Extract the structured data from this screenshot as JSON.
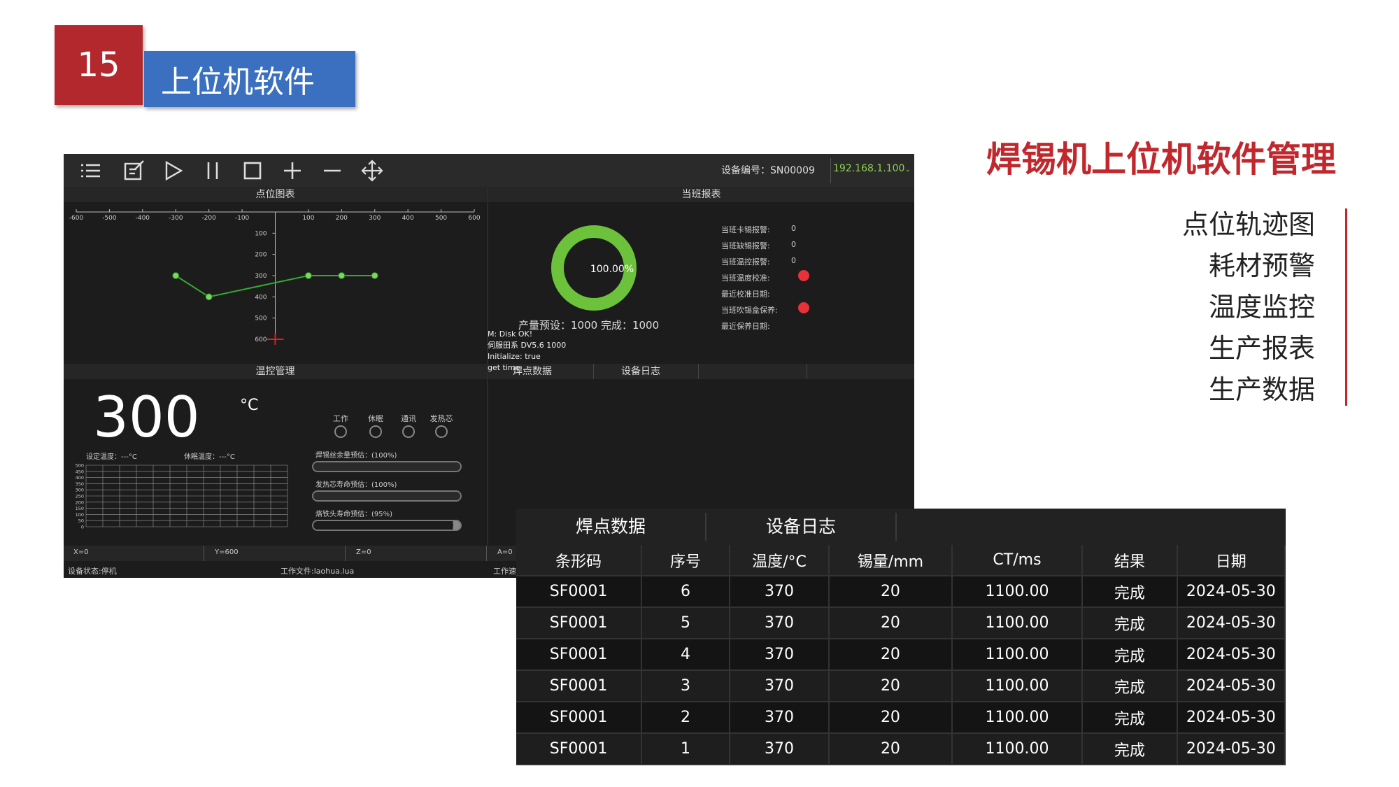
{
  "slide": {
    "number": "15",
    "title": "上位机软件",
    "heading": "焊锡机上位机软件管理",
    "features": [
      "点位轨迹图",
      "耗材预警",
      "温度监控",
      "生产报表",
      "生产数据"
    ]
  },
  "toolbar": {
    "icons": [
      "menu-icon",
      "edit-icon",
      "play-icon",
      "pause-icon",
      "stop-icon",
      "plus-icon",
      "minus-icon",
      "move-icon"
    ],
    "device_id": "设备编号：SN00009",
    "ip": "192.168.1.100"
  },
  "panels": {
    "point_chart": "点位图表",
    "shift_report": "当班报表",
    "temp_management": "温控管理",
    "solder_data_tab": "焊点数据",
    "device_log_tab": "设备日志"
  },
  "chart_data": {
    "type": "line",
    "x_ticks": [
      "-600",
      "-500",
      "-400",
      "-300",
      "-200",
      "-100",
      "100",
      "200",
      "300",
      "400",
      "500",
      "600"
    ],
    "y_ticks": [
      "100",
      "200",
      "300",
      "400",
      "500",
      "600"
    ],
    "x": [
      -300,
      -200,
      100,
      200,
      300
    ],
    "y": [
      300,
      400,
      300,
      300,
      300
    ],
    "xlim": [
      -600,
      600
    ],
    "ylim": [
      0,
      600
    ],
    "line_color": "#33aa33",
    "point_color": "#7ad85a"
  },
  "shift": {
    "donut_percent": 100,
    "donut_label": "100.00%",
    "production": "产量预设：1000  完成：1000",
    "rows": [
      {
        "label": "当班卡锡报警:",
        "value": "0"
      },
      {
        "label": "当班缺锡报警:",
        "value": "0"
      },
      {
        "label": "当班温控报警:",
        "value": "0"
      },
      {
        "label": "当班温度校准:",
        "value": ""
      },
      {
        "label": "最近校准日期:",
        "value": ""
      },
      {
        "label": "当班吹锡盒保养:",
        "value": ""
      },
      {
        "label": "最近保养日期:",
        "value": ""
      }
    ]
  },
  "temperature": {
    "value": "300",
    "unit": "°C",
    "status_labels": [
      "工作",
      "休眠",
      "通讯",
      "发热芯"
    ],
    "set_temp": "设定温度：---°C",
    "sleep_temp": "休眠温度：---°C",
    "grid_ticks": [
      "500",
      "450",
      "400",
      "350",
      "300",
      "250",
      "200",
      "150",
      "100",
      "50",
      "0"
    ],
    "bars": [
      {
        "label": "焊锡丝余量预估：(100%)",
        "percent": 100
      },
      {
        "label": "发热芯寿命预估：(100%)",
        "percent": 100
      },
      {
        "label": "烙铁头寿命预估：(95%)",
        "percent": 95
      }
    ]
  },
  "log": [
    "M: Disk OK!",
    "伺服田系 DV5.6 1000",
    "Initialize: true",
    "get time ...."
  ],
  "coords": {
    "x": "X=0",
    "y": "Y=600",
    "z": "Z=0",
    "a": "A=0"
  },
  "status": {
    "device_state": "设备状态:停机",
    "work_file": "工作文件:laohua.lua",
    "extra": "工作速"
  },
  "table": {
    "tabs": [
      "焊点数据",
      "设备日志"
    ],
    "headers": [
      "条形码",
      "序号",
      "温度/°C",
      "锡量/mm",
      "CT/ms",
      "结果",
      "日期"
    ],
    "rows": [
      [
        "SF0001",
        "6",
        "370",
        "20",
        "1100.00",
        "完成",
        "2024-05-30"
      ],
      [
        "SF0001",
        "5",
        "370",
        "20",
        "1100.00",
        "完成",
        "2024-05-30"
      ],
      [
        "SF0001",
        "4",
        "370",
        "20",
        "1100.00",
        "完成",
        "2024-05-30"
      ],
      [
        "SF0001",
        "3",
        "370",
        "20",
        "1100.00",
        "完成",
        "2024-05-30"
      ],
      [
        "SF0001",
        "2",
        "370",
        "20",
        "1100.00",
        "完成",
        "2024-05-30"
      ],
      [
        "SF0001",
        "1",
        "370",
        "20",
        "1100.00",
        "完成",
        "2024-05-30"
      ]
    ]
  }
}
